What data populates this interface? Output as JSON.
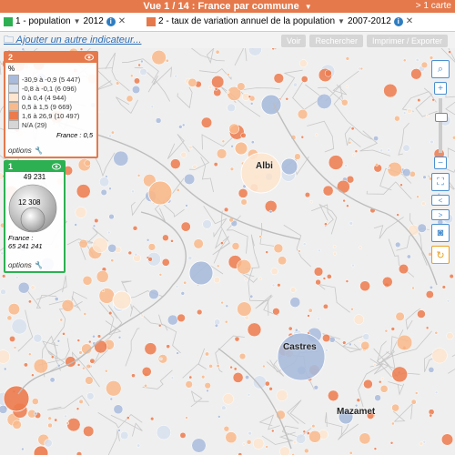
{
  "title": {
    "text": "Vue 1 / 14 : France par commune",
    "right": "> 1 carte"
  },
  "indicators": [
    {
      "num": "1",
      "label": "1 - population",
      "year": "2012",
      "color": "#2db052"
    },
    {
      "num": "2",
      "label": "2 - taux de variation annuel de la population",
      "year": "2007-2012",
      "color": "#e5794b"
    }
  ],
  "add_indicator": "Ajouter un autre indicateur...",
  "toolbar": {
    "voir": "Voir",
    "rechercher": "Rechercher",
    "imprimer": "Imprimer / Exporter"
  },
  "panel2": {
    "num": "2",
    "unit": "%",
    "legend": [
      {
        "label": "-30,9 à -0,9 (5 447)",
        "color": "#a9bbdc"
      },
      {
        "label": "-0,8 à -0,1 (6 096)",
        "color": "#d7e0ef"
      },
      {
        "label": "0 à 0,4 (4 944)",
        "color": "#fde5cf"
      },
      {
        "label": "0,5 à 1,5 (9 669)",
        "color": "#f9b98a"
      },
      {
        "label": "1,6 à 26,9 (10 497)",
        "color": "#ec7a4c"
      },
      {
        "label": "N/A (29)",
        "color": "#d6d6d6"
      }
    ],
    "france": "France : 0,5",
    "options": "options"
  },
  "panel1": {
    "num": "1",
    "max": "49 231",
    "mid": "12 308",
    "france_label": "France :",
    "france_value": "65 241 241",
    "options": "options"
  },
  "cities": {
    "albi": "Albi",
    "castres": "Castres",
    "mazamet": "Mazamet"
  }
}
